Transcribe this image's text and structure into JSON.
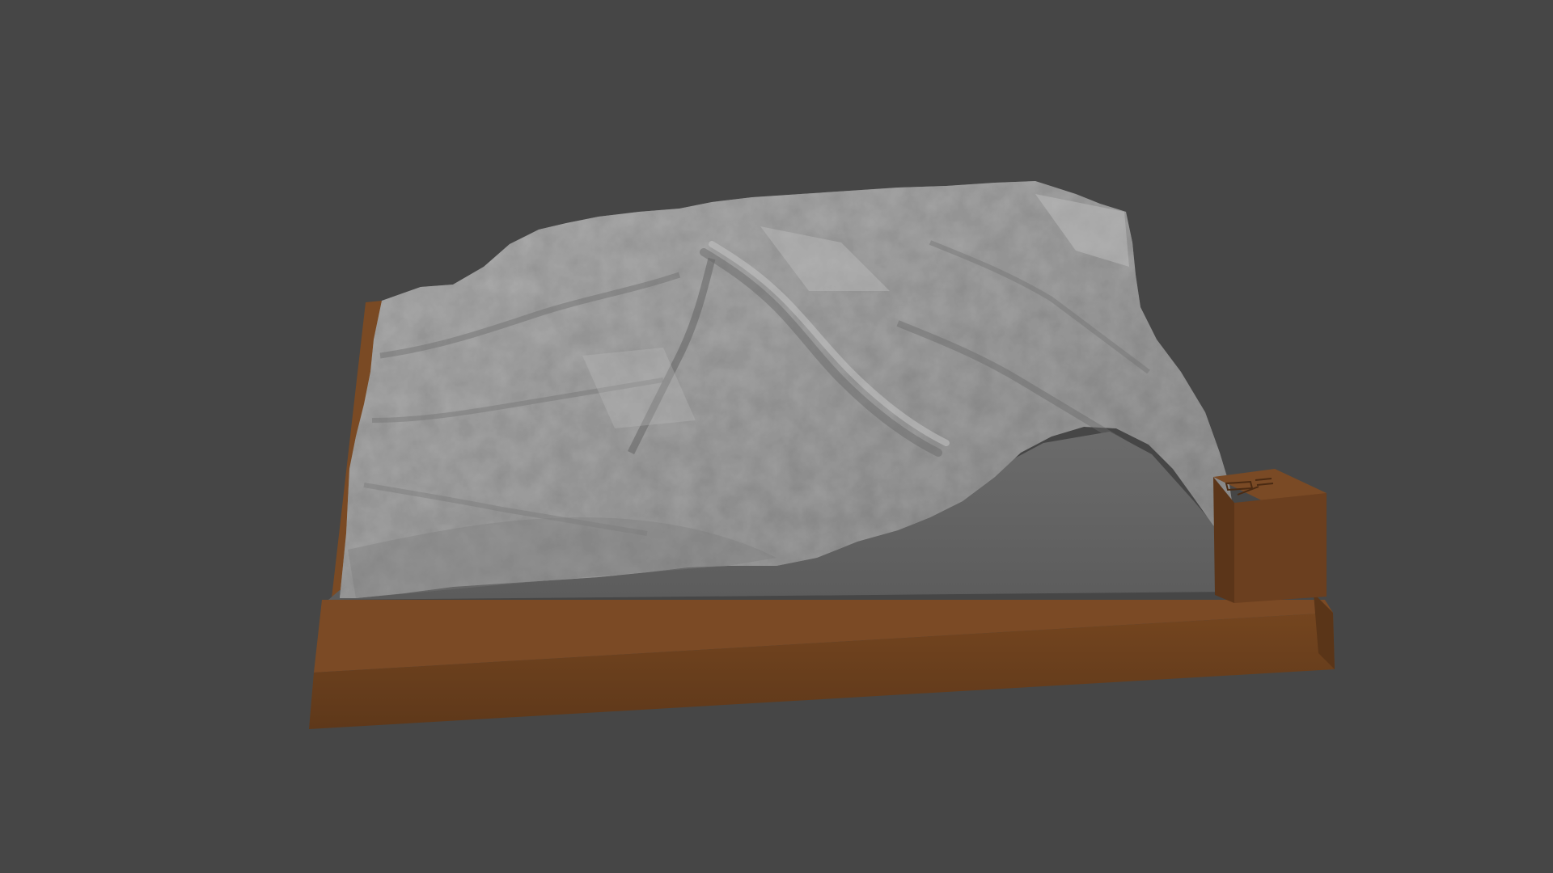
{
  "scene": {
    "background_color": "#464646",
    "objects": [
      {
        "name": "terrain-relief-model",
        "material_color": "#9a9a9a"
      },
      {
        "name": "base-frame",
        "material_color": "#6b3f20"
      },
      {
        "name": "title-plaque",
        "material_color": "#6b3f20"
      }
    ]
  }
}
